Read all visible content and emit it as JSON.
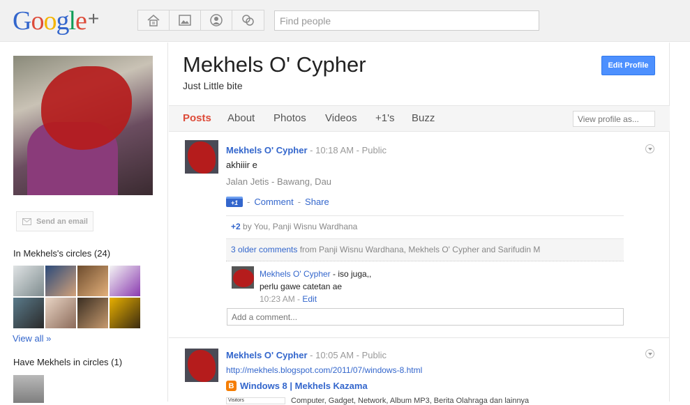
{
  "header": {
    "logo": {
      "g": "G",
      "o1": "o",
      "o2": "o",
      "g2": "g",
      "l": "l",
      "e": "e",
      "plus": "+"
    },
    "nav_icons": [
      "home-icon",
      "photos-icon",
      "profile-icon",
      "circles-icon"
    ],
    "search": {
      "placeholder": "Find people",
      "value": ""
    }
  },
  "sidebar": {
    "send_email_label": "Send an email",
    "in_circles_heading": "In Mekhels's circles (24)",
    "view_all_label": "View all »",
    "have_in_circles_heading": "Have Mekhels in circles (1)"
  },
  "profile": {
    "name": "Mekhels O' Cypher",
    "tagline": "Just Little bite",
    "edit_button": "Edit Profile",
    "view_as_placeholder": "View profile as..."
  },
  "tabs": [
    "Posts",
    "About",
    "Photos",
    "Videos",
    "+1's",
    "Buzz"
  ],
  "active_tab": "Posts",
  "posts": [
    {
      "author": "Mekhels O' Cypher",
      "sep1": " - ",
      "time": "10:18 AM",
      "sep2": " - ",
      "visibility": "Public",
      "body": "akhiiir e",
      "location": "Jalan Jetis - Bawang, Dau",
      "plusone_badge": "+1",
      "comment_label": "Comment",
      "share_label": "Share",
      "plus_count": "+2",
      "plus_by": " by You, Panji Wisnu Wardhana",
      "older_comments_link": "3 older comments",
      "older_comments_from": " from Panji Wisnu Wardhana, Mekhels O' Cypher and Sarifudin M",
      "comment": {
        "author": "Mekhels O' Cypher",
        "text_line1": " - iso juga,,",
        "text_line2": "perlu gawe catetan ae",
        "time": "10:23 AM",
        "edit_label": "Edit"
      },
      "add_comment_placeholder": "Add a comment..."
    },
    {
      "author": "Mekhels O' Cypher",
      "sep1": " - ",
      "time": "10:05 AM",
      "sep2": " - ",
      "visibility": "Public",
      "link_url": "http://mekhels.blogspot.com/2011/07/windows-8.html",
      "link_title": "Windows 8 | Mekhels Kazama",
      "blogger_glyph": "B",
      "thumb_text": "Visitors",
      "snippet": "Computer, Gadget, Network, Album MP3, Berita Olahraga dan lainnya"
    }
  ]
}
